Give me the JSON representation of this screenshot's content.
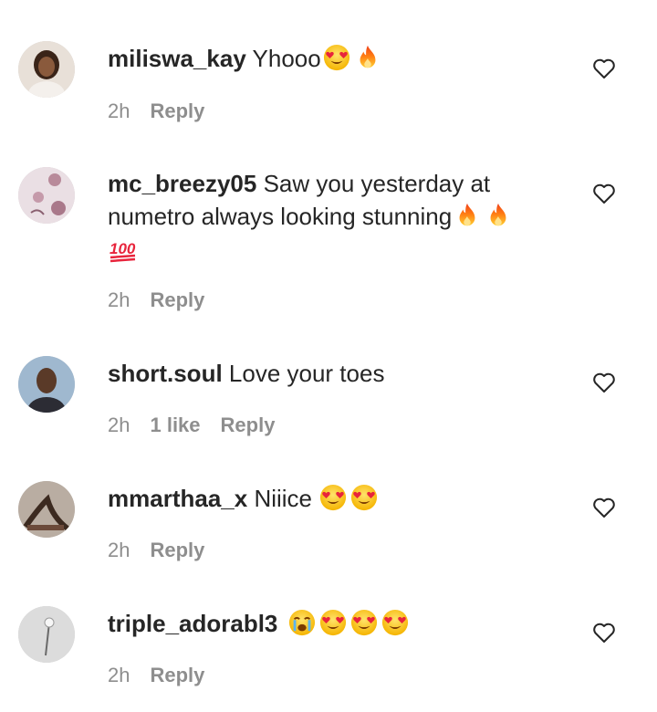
{
  "comments": [
    {
      "username": "miliswa_kay",
      "text": "Yhooo",
      "emojis": [
        "heart-eyes",
        "fire"
      ],
      "time": "2h",
      "reply_label": "Reply"
    },
    {
      "username": "mc_breezy05",
      "text": "Saw you yesterday at numetro always looking stunning",
      "emojis": [
        "fire",
        "fire",
        "hundred-points"
      ],
      "time": "2h",
      "reply_label": "Reply"
    },
    {
      "username": "short.soul",
      "text": "Love your toes",
      "emojis": [],
      "time": "2h",
      "likes": "1 like",
      "reply_label": "Reply"
    },
    {
      "username": "mmarthaa_x",
      "text": "Niiice",
      "emojis": [
        "heart-eyes",
        "heart-eyes"
      ],
      "time": "2h",
      "reply_label": "Reply"
    },
    {
      "username": "triple_adorabl3",
      "text": "",
      "emojis": [
        "crying",
        "heart-eyes",
        "heart-eyes",
        "heart-eyes"
      ],
      "time": "2h",
      "reply_label": "Reply"
    }
  ],
  "colors": {
    "text": "#262626",
    "meta": "#8e8e8e",
    "background": "#ffffff"
  }
}
